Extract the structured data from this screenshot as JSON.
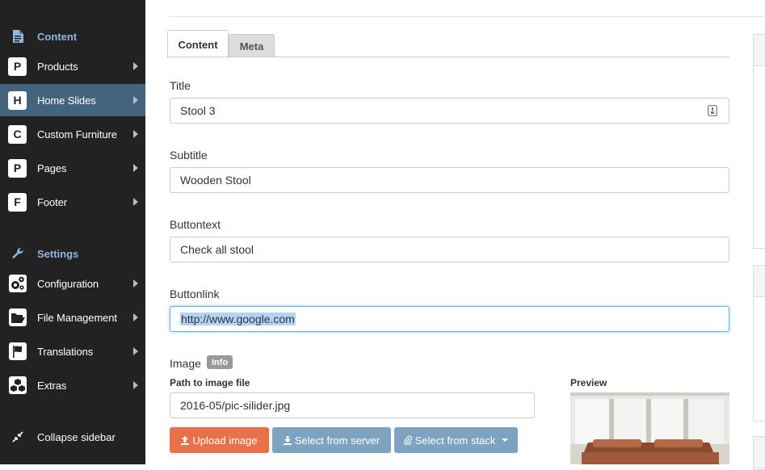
{
  "sidebar": {
    "content_heading": "Content",
    "content_items": [
      {
        "badge": "P",
        "label": "Products"
      },
      {
        "badge": "H",
        "label": "Home Slides"
      },
      {
        "badge": "C",
        "label": "Custom Furniture"
      },
      {
        "badge": "P",
        "label": "Pages"
      },
      {
        "badge": "F",
        "label": "Footer"
      }
    ],
    "settings_heading": "Settings",
    "settings_items": [
      {
        "icon": "gears-icon",
        "label": "Configuration"
      },
      {
        "icon": "folder-open-icon",
        "label": "File Management"
      },
      {
        "icon": "flag-icon",
        "label": "Translations"
      },
      {
        "icon": "cubes-icon",
        "label": "Extras"
      }
    ],
    "collapse_label": "Collapse sidebar"
  },
  "tabs": [
    {
      "label": "Content",
      "active": true
    },
    {
      "label": "Meta",
      "active": false
    }
  ],
  "form": {
    "title_label": "Title",
    "title_value": "Stool 3",
    "subtitle_label": "Subtitle",
    "subtitle_value": "Wooden Stool",
    "buttontext_label": "Buttontext",
    "buttontext_value": "Check all stool",
    "buttonlink_label": "Buttonlink",
    "buttonlink_value": "http://www.google.com",
    "image_label": "Image",
    "image_info": "Info",
    "path_label": "Path to image file",
    "path_value": "2016-05/pic-silider.jpg",
    "preview_label": "Preview"
  },
  "buttons": {
    "upload": "Upload image",
    "select_server": "Select from server",
    "select_stack": "Select from stack"
  },
  "colors": {
    "sidebar_bg": "#222222",
    "sidebar_active": "#44637f",
    "heading_accent": "#8fb6dd",
    "upload_btn": "#e8714a",
    "select_btn": "#7ea3c2"
  }
}
